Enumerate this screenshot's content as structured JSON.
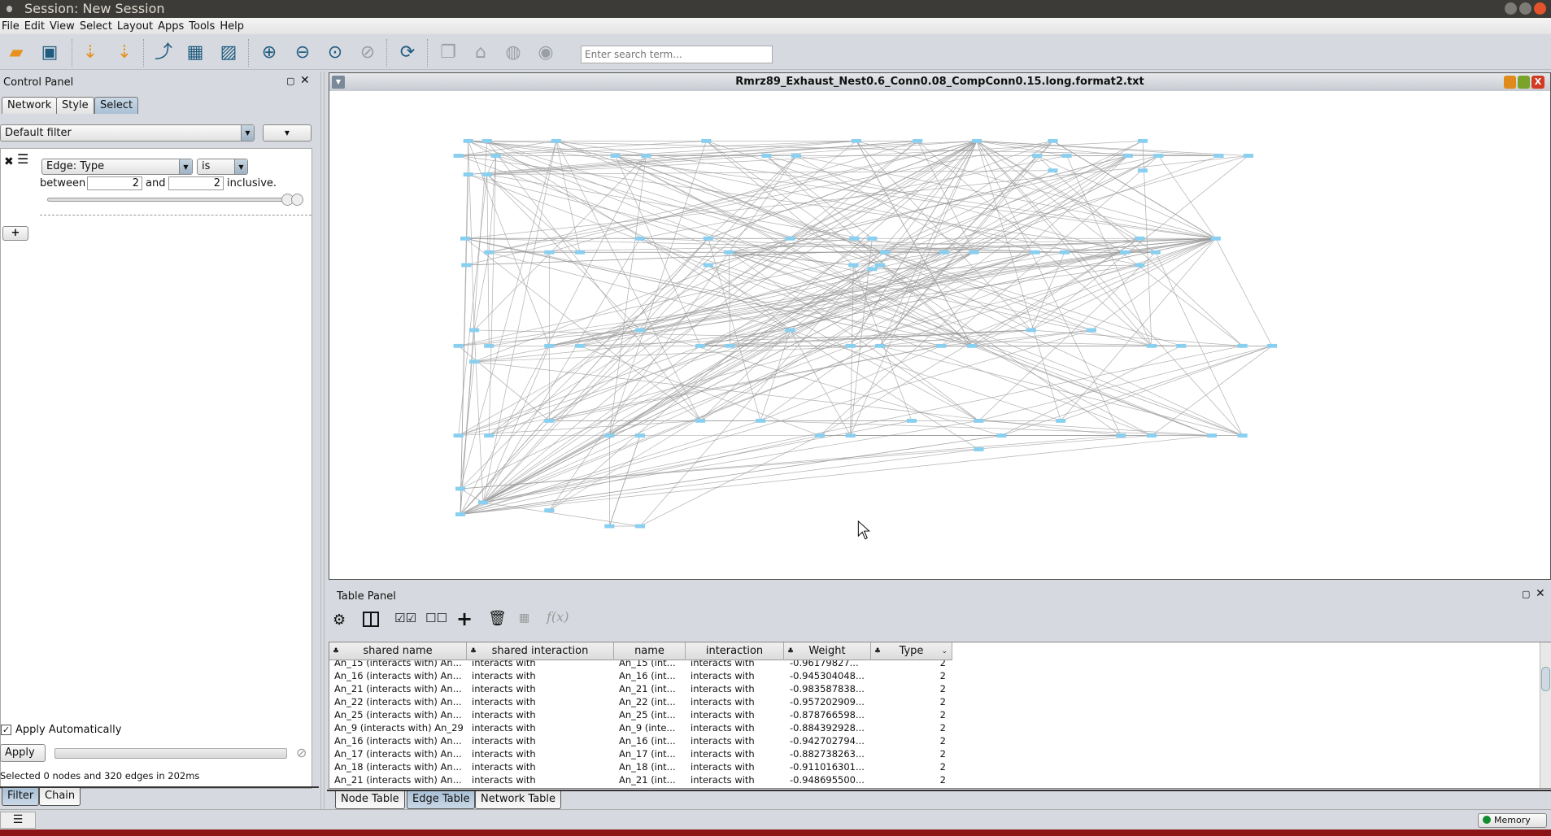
{
  "window": {
    "title": "Session: New Session"
  },
  "menu": [
    "File",
    "Edit",
    "View",
    "Select",
    "Layout",
    "Apps",
    "Tools",
    "Help"
  ],
  "toolbar": {
    "search_placeholder": "Enter search term...",
    "icons": [
      "open-session-icon",
      "save-session-icon",
      "import-network-icon",
      "import-table-icon",
      "export-network-icon",
      "export-table-icon",
      "export-image-icon",
      "zoom-in-icon",
      "zoom-out-icon",
      "zoom-fit-icon",
      "zoom-selected-icon",
      "refresh-layout-icon",
      "new-network-from-selection-icon",
      "show-all-icon",
      "hide-selected-icon",
      "show-icon"
    ]
  },
  "control_panel": {
    "title": "Control Panel",
    "tabs": [
      "Network",
      "Style",
      "Select"
    ],
    "active_tab": "Select",
    "filter_select": "Default filter",
    "filter": {
      "column": "Edge: Type",
      "operator": "is",
      "between_label": "between",
      "min": "2",
      "and_label": "and",
      "max": "2",
      "inclusive_label": "inclusive.",
      "slider_low": 1.0,
      "slider_high": 1.0
    },
    "apply_automatically": "Apply Automatically",
    "apply_auto_checked": true,
    "apply_label": "Apply",
    "status": "Selected 0 nodes and 320 edges in 202ms",
    "bottom_tabs": [
      "Filter",
      "Chain"
    ],
    "active_bottom_tab": "Filter"
  },
  "network": {
    "title": "Rmrz89_Exhaust_Nest0.6_Conn0.08_CompConn0.15.long.format2.txt",
    "node_color": "#88cff0",
    "edge_color": "#9a9a9a"
  },
  "table_panel": {
    "title": "Table Panel",
    "columns": [
      "shared name",
      "shared interaction",
      "name",
      "interaction",
      "Weight",
      "Type"
    ],
    "rows": [
      [
        "An_15 (interacts with) An...",
        "interacts with",
        "An_15 (int...",
        "interacts with",
        "-0.96179827...",
        "2"
      ],
      [
        "An_16 (interacts with) An...",
        "interacts with",
        "An_16 (int...",
        "interacts with",
        "-0.945304048...",
        "2"
      ],
      [
        "An_21 (interacts with) An...",
        "interacts with",
        "An_21 (int...",
        "interacts with",
        "-0.983587838...",
        "2"
      ],
      [
        "An_22 (interacts with) An...",
        "interacts with",
        "An_22 (int...",
        "interacts with",
        "-0.957202909...",
        "2"
      ],
      [
        "An_25 (interacts with) An...",
        "interacts with",
        "An_25 (int...",
        "interacts with",
        "-0.878766598...",
        "2"
      ],
      [
        "An_9 (interacts with) An_29",
        "interacts with",
        "An_9 (inte...",
        "interacts with",
        "-0.884392928...",
        "2"
      ],
      [
        "An_16 (interacts with) An...",
        "interacts with",
        "An_16 (int...",
        "interacts with",
        "-0.942702794...",
        "2"
      ],
      [
        "An_17 (interacts with) An...",
        "interacts with",
        "An_17 (int...",
        "interacts with",
        "-0.882738263...",
        "2"
      ],
      [
        "An_18 (interacts with) An...",
        "interacts with",
        "An_18 (int...",
        "interacts with",
        "-0.911016301...",
        "2"
      ],
      [
        "An_21 (interacts with) An...",
        "interacts with",
        "An_21 (int...",
        "interacts with",
        "-0.948695500...",
        "2"
      ]
    ],
    "tabs": [
      "Node Table",
      "Edge Table",
      "Network Table"
    ],
    "active_tab": "Edge Table"
  },
  "statusbar": {
    "memory_label": "Memory",
    "memory_color": "#118c2e"
  }
}
